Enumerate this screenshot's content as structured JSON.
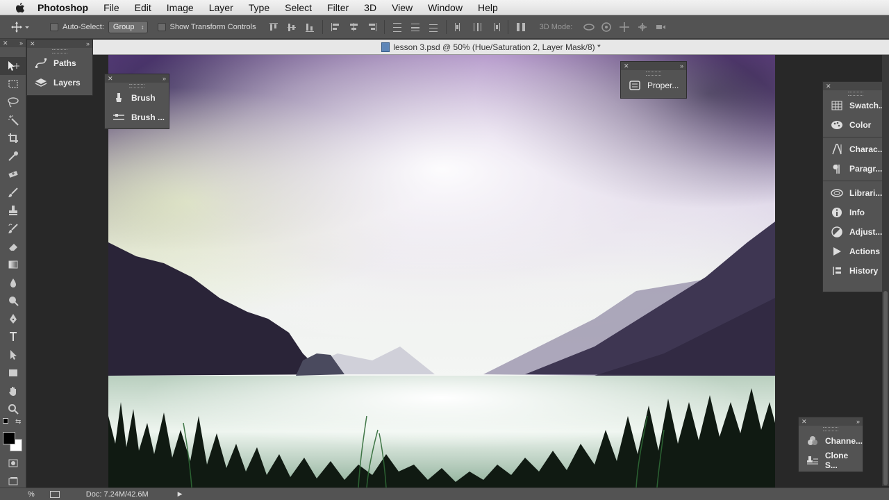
{
  "menubar": {
    "app": "Photoshop",
    "items": [
      "File",
      "Edit",
      "Image",
      "Layer",
      "Type",
      "Select",
      "Filter",
      "3D",
      "View",
      "Window",
      "Help"
    ]
  },
  "options": {
    "auto_select_label": "Auto-Select:",
    "auto_select_value": "Group",
    "transform_label": "Show Transform Controls",
    "mode3d_label": "3D Mode:"
  },
  "document": {
    "tab_title": "lesson 3.psd @ 50% (Hue/Saturation 2, Layer Mask/8) *"
  },
  "panels": {
    "left_group": [
      {
        "label": "Paths",
        "icon": "paths-icon"
      },
      {
        "label": "Layers",
        "icon": "layers-icon"
      }
    ],
    "brush_group": [
      {
        "label": "Brush",
        "icon": "brush-icon"
      },
      {
        "label": "Brush ...",
        "icon": "brush-presets-icon"
      }
    ],
    "properties_label": "Proper...",
    "right_group_a": [
      {
        "label": "Swatch...",
        "icon": "swatches-icon"
      },
      {
        "label": "Color",
        "icon": "color-icon"
      }
    ],
    "right_group_b": [
      {
        "label": "Charac...",
        "icon": "character-icon"
      },
      {
        "label": "Paragr...",
        "icon": "paragraph-icon"
      }
    ],
    "right_group_c": [
      {
        "label": "Librari...",
        "icon": "libraries-icon"
      },
      {
        "label": "Info",
        "icon": "info-icon"
      },
      {
        "label": "Adjust...",
        "icon": "adjustments-icon"
      },
      {
        "label": "Actions",
        "icon": "actions-icon"
      },
      {
        "label": "History",
        "icon": "history-icon"
      }
    ],
    "bottom_group": [
      {
        "label": "Channe...",
        "icon": "channels-icon"
      },
      {
        "label": "Clone S...",
        "icon": "clone-source-icon"
      }
    ]
  },
  "status": {
    "zoom": "%",
    "doc_size": "Doc: 7.24M/42.6M"
  }
}
